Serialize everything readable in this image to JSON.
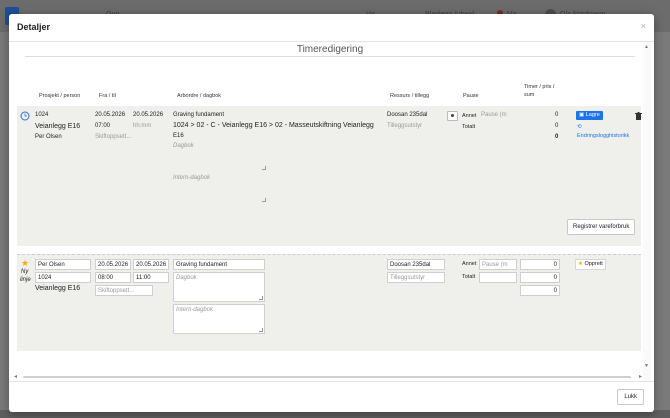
{
  "background": {
    "app_name": "Quo…",
    "nav1": "Vis…",
    "nav2": "Planlegg Arbeid",
    "nav3": "Ma…",
    "user": "Ola Nordmann"
  },
  "modal": {
    "title": "Detaljer",
    "close": "×",
    "section_title": "Timeredigering",
    "footer": {
      "close_label": "Lukk"
    }
  },
  "columns": {
    "project": "Prosjekt / person",
    "fromto": "Fra / til",
    "order": "Arbordre / dagbok",
    "resource": "Ressurs / tillegg",
    "pause": "Pause",
    "timer1": "Timer / pris /",
    "timer2": "sum"
  },
  "entry": {
    "project_no": "1024",
    "project_name": "Veianlegg E16",
    "person": "Per Olsen",
    "date_from": "20.05.2026",
    "date_to": "20.05.2026",
    "time_from": "07:00",
    "time_to_placeholder": "hh:mm",
    "shift": "Skiftoppsett...",
    "work_order": "Graving fundament",
    "order_path": "1024 > 02 - C - Veianlegg E16 > 02 - Masseutskiftning Veianlegg",
    "order_path2": "E16",
    "diary_placeholder": "Dagbok",
    "internal_placeholder": "Intern-dagbok",
    "resource": "Doosan 235dal",
    "addon_placeholder": "Tilleggsutstyr",
    "pause_label": "Annet",
    "pause_placeholder": "Pause (m",
    "total_label": "Totalt",
    "hours": "0",
    "price": "0",
    "sum": "0",
    "save_label": "Lagre",
    "history_label": "Endringslogghistorikk",
    "register_label": "Registrer vareforbruk"
  },
  "new_line": {
    "label1": "Ny",
    "label2": "linje",
    "person": "Per Olsen",
    "project_no": "1024",
    "project_name": "Veianlegg E16",
    "date_from": "20.05.2026",
    "date_to": "20.05.2026",
    "time_from": "08:00",
    "time_to": "11:00",
    "shift_placeholder": "Skiftoppsett...",
    "work_order": "Graving fundament",
    "diary_placeholder": "Dagbok",
    "internal_placeholder": "Intern-dagbok",
    "resource": "Doosan 235dal",
    "addon_placeholder": "Tilleggsutstyr",
    "pause_label": "Annet",
    "pause_placeholder": "Pause (m",
    "total_label": "Totalt",
    "hours": "0",
    "price": "0",
    "sum": "0",
    "create_label": "Opprett"
  }
}
